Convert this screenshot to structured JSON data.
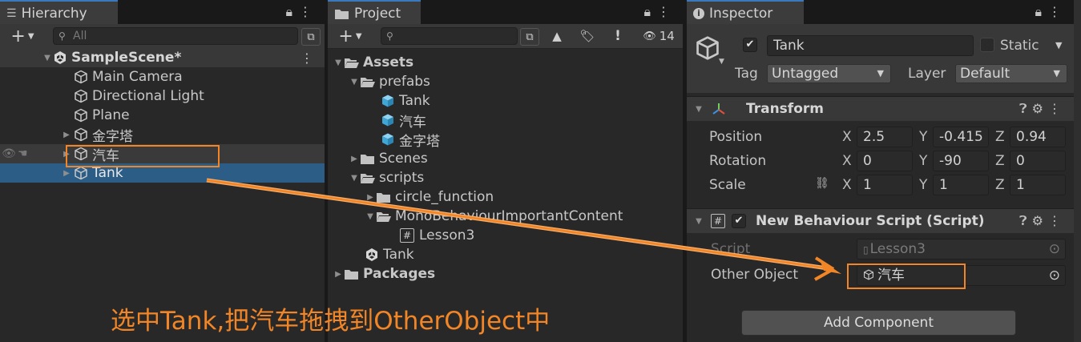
{
  "hierarchy": {
    "tab_title": "Hierarchy",
    "add_label": "+",
    "search_placeholder": "All",
    "scene_name": "SampleScene*",
    "items": [
      {
        "label": "Main Camera"
      },
      {
        "label": "Directional Light"
      },
      {
        "label": "Plane"
      },
      {
        "label": "金字塔"
      },
      {
        "label": "汽车"
      },
      {
        "label": "Tank"
      }
    ]
  },
  "project": {
    "tab_title": "Project",
    "add_label": "+",
    "search_value": "",
    "hidden_count": "14",
    "tree": {
      "assets": "Assets",
      "prefabs": "prefabs",
      "prefab_items": [
        "Tank",
        "汽车",
        "金字塔"
      ],
      "scenes": "Scenes",
      "scripts": "scripts",
      "circle_function": "circle_function",
      "mono_folder": "MonoBehaviourImportantContent",
      "lesson3": "Lesson3",
      "tank_root": "Tank",
      "packages": "Packages"
    }
  },
  "inspector": {
    "tab_title": "Inspector",
    "object_name": "Tank",
    "static_label": "Static",
    "tag_label": "Tag",
    "tag_value": "Untagged",
    "layer_label": "Layer",
    "layer_value": "Default",
    "transform": {
      "title": "Transform",
      "position_label": "Position",
      "rotation_label": "Rotation",
      "scale_label": "Scale",
      "axis_x": "X",
      "axis_y": "Y",
      "axis_z": "Z",
      "position": [
        "2.5",
        "-0.415",
        "0.94"
      ],
      "rotation": [
        "0",
        "-90",
        "0"
      ],
      "scale": [
        "1",
        "1",
        "1"
      ]
    },
    "script_component": {
      "title": "New Behaviour Script (Script)",
      "script_label": "Script",
      "script_value": "Lesson3",
      "other_label": "Other Object",
      "other_value": "汽车"
    },
    "add_component_label": "Add Component"
  },
  "annotation": {
    "caption": "选中Tank,把汽车拖拽到OtherObject中",
    "color": "#f28627"
  },
  "colors": {
    "selection": "#2c5d87",
    "panel": "#282828",
    "header": "#383838"
  }
}
